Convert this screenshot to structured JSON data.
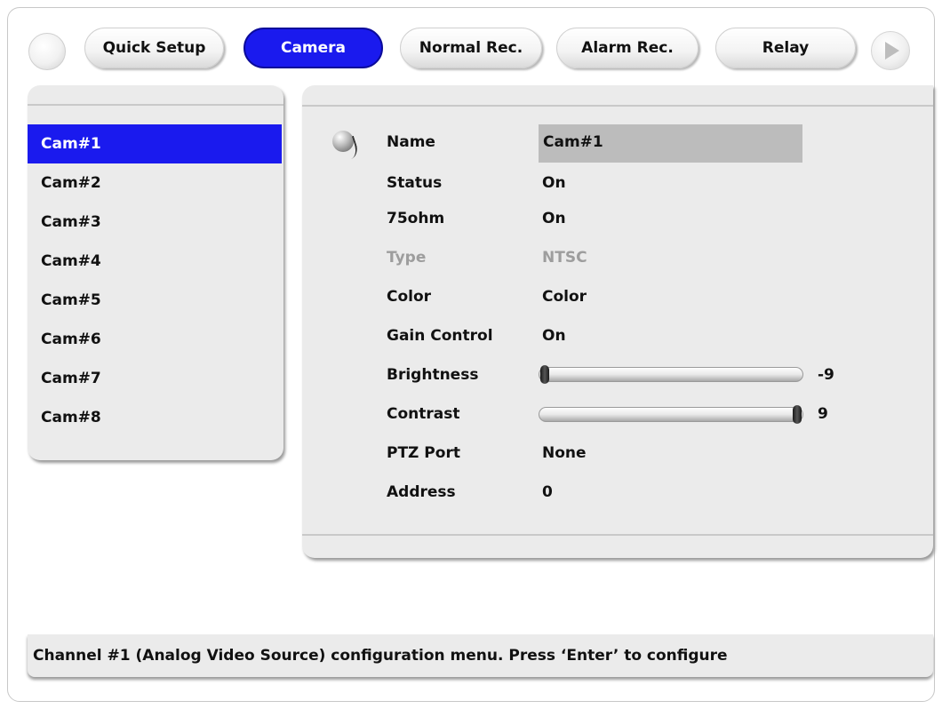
{
  "nav": {
    "tabs": [
      {
        "label": "Quick Setup"
      },
      {
        "label": "Camera"
      },
      {
        "label": "Normal Rec."
      },
      {
        "label": "Alarm Rec."
      },
      {
        "label": "Relay"
      }
    ],
    "active_tab": "Camera"
  },
  "sidebar": {
    "items": [
      "Cam#1",
      "Cam#2",
      "Cam#3",
      "Cam#4",
      "Cam#5",
      "Cam#6",
      "Cam#7",
      "Cam#8"
    ],
    "selected": "Cam#1"
  },
  "settings": {
    "name": {
      "label": "Name",
      "value": "Cam#1"
    },
    "status": {
      "label": "Status",
      "value": "On"
    },
    "ohm": {
      "label": "75ohm",
      "value": "On"
    },
    "type": {
      "label": "Type",
      "value": "NTSC"
    },
    "color": {
      "label": "Color",
      "value": "Color"
    },
    "gain": {
      "label": "Gain Control",
      "value": "On"
    },
    "brightness": {
      "label": "Brightness",
      "value": "-9",
      "level": 0.0
    },
    "contrast": {
      "label": "Contrast",
      "value": "9",
      "level": 1.0
    },
    "ptz": {
      "label": "PTZ Port",
      "value": "None"
    },
    "address": {
      "label": "Address",
      "value": "0"
    }
  },
  "status_bar": {
    "text": "Channel #1 (Analog Video Source) configuration menu. Press ‘Enter’ to configure"
  },
  "colors": {
    "accent": "#1a1aee",
    "panel": "#ebebeb",
    "disabled_text": "#9d9d9d"
  },
  "icons": {
    "left_button": "circle-button-icon",
    "right_button": "play-arrow-icon",
    "row_bullet": "cursor-bullet-icon"
  }
}
